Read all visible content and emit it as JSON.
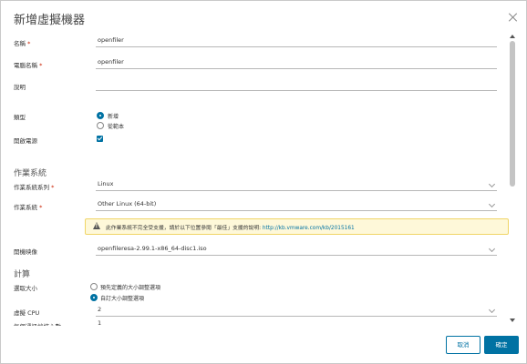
{
  "dialog": {
    "title": "新增虛擬機器",
    "close_icon": "close-icon"
  },
  "form": {
    "name": {
      "label": "名稱",
      "required": "*",
      "value": "openfiler"
    },
    "computer_name": {
      "label": "電腦名稱",
      "required": "*",
      "value": "openfiler"
    },
    "description": {
      "label": "說明",
      "value": ""
    },
    "type": {
      "label": "類型",
      "options": [
        "新增",
        "從範本"
      ],
      "selected": "新增"
    },
    "power_on": {
      "label": "開啟電源",
      "checked": true
    },
    "os_section": {
      "title": "作業系統"
    },
    "os_family": {
      "label": "作業系統系列",
      "required": "*",
      "value": "Linux"
    },
    "os": {
      "label": "作業系統",
      "required": "*",
      "value": "Other Linux (64-bit)"
    },
    "warning": {
      "text": "此作業系統不完全受支援，請於以下位置參閱「最佳」支援的說明:",
      "link": "http://kb.vmware.com/kb/2015161"
    },
    "boot_image": {
      "label": "開機映像",
      "value": "openfileresa-2.99.1-x86_64-disc1.iso"
    },
    "compute_section": {
      "title": "計算"
    },
    "size_select": {
      "label": "選取大小",
      "options": [
        "預先定義的大小調整選項",
        "自訂大小調整選項"
      ],
      "selected": "自訂大小調整選項"
    },
    "vcpu": {
      "label": "虛擬 CPU",
      "value": "2"
    },
    "cores_per_socket": {
      "label": "每個通訊端核心數",
      "value": "1"
    }
  },
  "footer": {
    "cancel_label": "取消",
    "ok_label": "確定"
  },
  "colors": {
    "accent": "#0072a3",
    "required": "#c92100",
    "warning_bg": "#fef8d9"
  }
}
